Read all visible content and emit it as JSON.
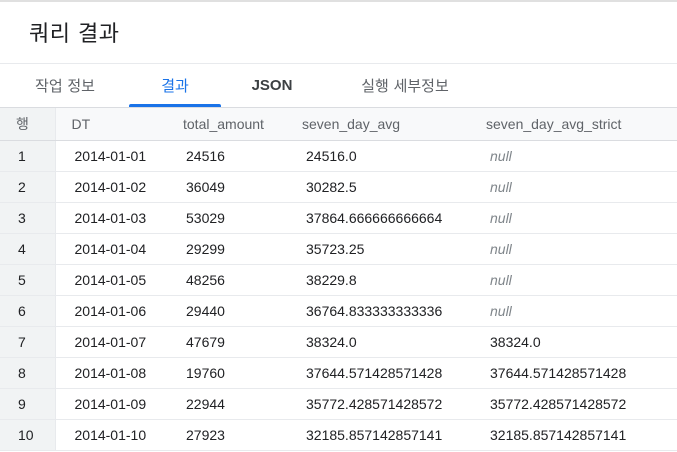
{
  "page": {
    "title": "쿼리 결과"
  },
  "tabs": [
    {
      "label": "작업 정보",
      "active": false
    },
    {
      "label": "결과",
      "active": true
    },
    {
      "label": "JSON",
      "active": false
    },
    {
      "label": "실행 세부정보",
      "active": false
    }
  ],
  "table": {
    "headers": {
      "row": "행",
      "dt": "DT",
      "total_amount": "total_amount",
      "seven_day_avg": "seven_day_avg",
      "seven_day_avg_strict": "seven_day_avg_strict"
    },
    "rows": [
      {
        "row": "1",
        "dt": "2014-01-01",
        "total_amount": "24516",
        "seven_day_avg": "24516.0",
        "seven_day_avg_strict": "null"
      },
      {
        "row": "2",
        "dt": "2014-01-02",
        "total_amount": "36049",
        "seven_day_avg": "30282.5",
        "seven_day_avg_strict": "null"
      },
      {
        "row": "3",
        "dt": "2014-01-03",
        "total_amount": "53029",
        "seven_day_avg": "37864.666666666664",
        "seven_day_avg_strict": "null"
      },
      {
        "row": "4",
        "dt": "2014-01-04",
        "total_amount": "29299",
        "seven_day_avg": "35723.25",
        "seven_day_avg_strict": "null"
      },
      {
        "row": "5",
        "dt": "2014-01-05",
        "total_amount": "48256",
        "seven_day_avg": "38229.8",
        "seven_day_avg_strict": "null"
      },
      {
        "row": "6",
        "dt": "2014-01-06",
        "total_amount": "29440",
        "seven_day_avg": "36764.833333333336",
        "seven_day_avg_strict": "null"
      },
      {
        "row": "7",
        "dt": "2014-01-07",
        "total_amount": "47679",
        "seven_day_avg": "38324.0",
        "seven_day_avg_strict": "38324.0"
      },
      {
        "row": "8",
        "dt": "2014-01-08",
        "total_amount": "19760",
        "seven_day_avg": "37644.571428571428",
        "seven_day_avg_strict": "37644.571428571428"
      },
      {
        "row": "9",
        "dt": "2014-01-09",
        "total_amount": "22944",
        "seven_day_avg": "35772.428571428572",
        "seven_day_avg_strict": "35772.428571428572"
      },
      {
        "row": "10",
        "dt": "2014-01-10",
        "total_amount": "27923",
        "seven_day_avg": "32185.857142857141",
        "seven_day_avg_strict": "32185.857142857141"
      }
    ]
  },
  "colors": {
    "accent": "#1a73e8",
    "null_text": "#80868b",
    "header_bg": "#f8f9fa",
    "rownum_bg": "#f1f3f4"
  }
}
